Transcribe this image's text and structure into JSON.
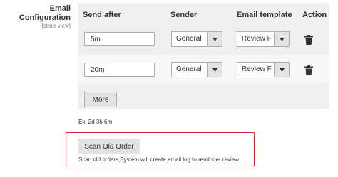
{
  "field": {
    "label": "Email Configuration",
    "scope": "[store view]"
  },
  "grid": {
    "columns": [
      "Send after",
      "Sender",
      "Email template",
      "Action"
    ],
    "rows": [
      {
        "send_after": "5m",
        "sender": "General",
        "template": "Review F"
      },
      {
        "send_after": "20m",
        "sender": "General",
        "template": "Review F"
      }
    ],
    "more_button": "More"
  },
  "hint": "Ex: 2d 3h 6m",
  "scan": {
    "button": "Scan Old Order",
    "description": "Scan old orders,System will create email log to reminder review"
  },
  "colors": {
    "highlight_border": "#e02b27",
    "button_bg": "#e3e3e3"
  },
  "icons": {
    "delete": "trash-icon",
    "dropdown": "triangle-down-icon"
  }
}
